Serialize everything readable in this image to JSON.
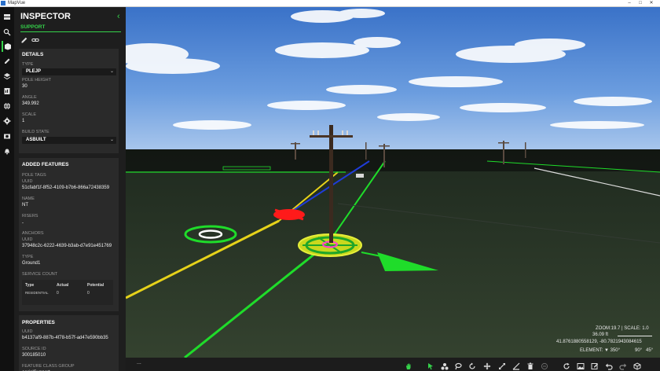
{
  "window": {
    "title": "MapVue",
    "controls": [
      "–",
      "□",
      "✕"
    ]
  },
  "rail": {
    "items": [
      {
        "icon": "layers-stack-icon"
      },
      {
        "icon": "search-icon"
      },
      {
        "icon": "inspector-box-icon",
        "active": true
      },
      {
        "icon": "edit-pen-icon"
      },
      {
        "icon": "layers-icon"
      },
      {
        "icon": "report-icon"
      },
      {
        "icon": "globe-icon"
      },
      {
        "icon": "settings-gear-icon"
      },
      {
        "icon": "camera-icon"
      },
      {
        "icon": "alert-bell-icon"
      }
    ],
    "accent": "#35d24a"
  },
  "inspector": {
    "title": "INSPECTOR",
    "collapse_glyph": "‹",
    "subtab": "SUPPORT",
    "details": {
      "title": "DETAILS",
      "type_label": "TYPE",
      "type_value": "PLEJP",
      "pole_height_label": "POLE HEIGHT",
      "pole_height_value": "30",
      "angle_label": "ANGLE",
      "angle_value": "349.992",
      "scale_label": "SCALE",
      "scale_value": "1",
      "build_state_label": "BUILD STATE",
      "build_state_value": "ASBUILT"
    },
    "added_features": {
      "title": "ADDED FEATURES",
      "pole_tags_label": "POLE TAGS",
      "uuid_label": "UUID",
      "uuid_value": "51cfabf1f-8f52-4109-b7b6-866a72438359",
      "name_label": "NAME",
      "name_value": "NT",
      "risers_label": "RISERS",
      "risers_value": "-",
      "anchors_label": "ANCHORS",
      "anchor_uuid_label": "UUID",
      "anchor_uuid_value": "37948c2c-6222-4639-b3ab-d7e91e451769",
      "anchor_type_label": "TYPE",
      "anchor_type_value": "Ground1",
      "service_count_label": "SERVICE COUNT",
      "service_table": {
        "headers": [
          "Type",
          "Actual",
          "Potential"
        ],
        "rows": [
          [
            "RESIDENTIAL",
            "0",
            "0"
          ]
        ]
      }
    },
    "properties": {
      "title": "PROPERTIES",
      "uuid_label": "UUID",
      "uuid_value": "b4137af9-887b-4f78-b57f-ad47e590bb35",
      "source_id_label": "SOURCE ID",
      "source_id_value": "300185010",
      "feature_class_label": "FEATURE CLASS GROUP",
      "feature_class_value": "aerialSupport"
    }
  },
  "viewport": {
    "zoom_text": "ZOOM:",
    "zoom_value": "19.7",
    "scale_text": "| SCALE: 1.0",
    "distance": "36.09 ft",
    "coords": "41.8761880558129, -80.7821943084615",
    "element_text": "ELEMENT: ▼ 350°",
    "angle_a": "90°",
    "angle_b": "45°",
    "colors": {
      "sky_top": "#3a72c8",
      "sky_bottom": "#a8c6ec",
      "ground": "#2e3a2a",
      "selection": "#d4e81c",
      "green": "#1fdc2a",
      "red": "#ff1a1a"
    }
  },
  "bottombar": {
    "left_dots": "...",
    "tools": [
      "hand-pan-icon",
      "select-arrow-icon",
      "group-shapes-icon",
      "lasso-icon",
      "rotate-icon",
      "move-icon",
      "scale-arrows-icon",
      "measure-angle-icon",
      "delete-trash-icon",
      "disabled-circle-icon",
      "refresh-icon",
      "image-snapshot-icon",
      "edit-box-icon",
      "undo-icon",
      "redo-icon",
      "view-cube-icon"
    ]
  }
}
